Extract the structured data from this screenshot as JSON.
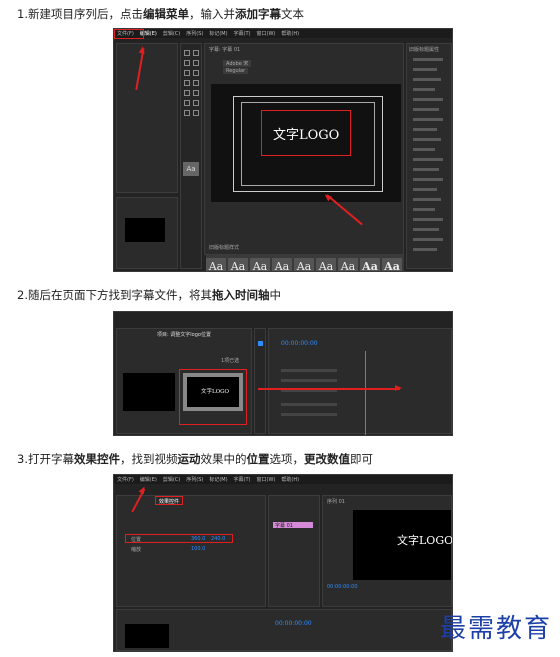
{
  "steps": [
    {
      "pre": "1.新建项目序列后，点击",
      "b1": "编辑菜单",
      "mid": "，输入并",
      "b2": "添加字幕",
      "post": "文本"
    },
    {
      "pre": "2.随后在页面下方找到字幕文件，将其",
      "b1": "拖入时间轴",
      "mid": "中",
      "b2": "",
      "post": ""
    },
    {
      "pre": "3.打开字幕",
      "b1": "效果控件",
      "mid": "，找到视频",
      "b2": "运动",
      "post": "效果中的位置选项，更改数值即可"
    }
  ],
  "step3_extra_bold": [
    "位置",
    "更改数值"
  ],
  "shot1": {
    "menu": [
      "文件(F)",
      "编辑(E)",
      "剪辑(C)",
      "序列(S)",
      "标记(M)",
      "字幕(T)",
      "窗口(W)",
      "帮助(H)"
    ],
    "title_text": "文字LOGO",
    "style_label": "Aa",
    "style_count": 9,
    "panel_label": "字幕: 字幕 01",
    "font_name": "Adobe 宋",
    "font_style": "Regular",
    "styles_header": "旧版标题样式",
    "props_header": "旧版标题属性"
  },
  "shot2": {
    "tab": "项目: 调整文字logo位置",
    "timecode": "00:00:00:00",
    "clip_label": "文字LOGO",
    "count": "1项已选"
  },
  "shot3": {
    "tab": "效果控件",
    "prop_position": "位置",
    "pos_x": "360.0",
    "pos_y": "240.0",
    "prop_scale": "缩放",
    "scale_val": "100.0",
    "timecode_left": "00:00:00:00",
    "timecode_bottom": "00:00:00:00",
    "preview_text": "文字LOGO",
    "seq_label": "序列 01",
    "clip_label": "字幕 01"
  },
  "watermark": "最需教育"
}
